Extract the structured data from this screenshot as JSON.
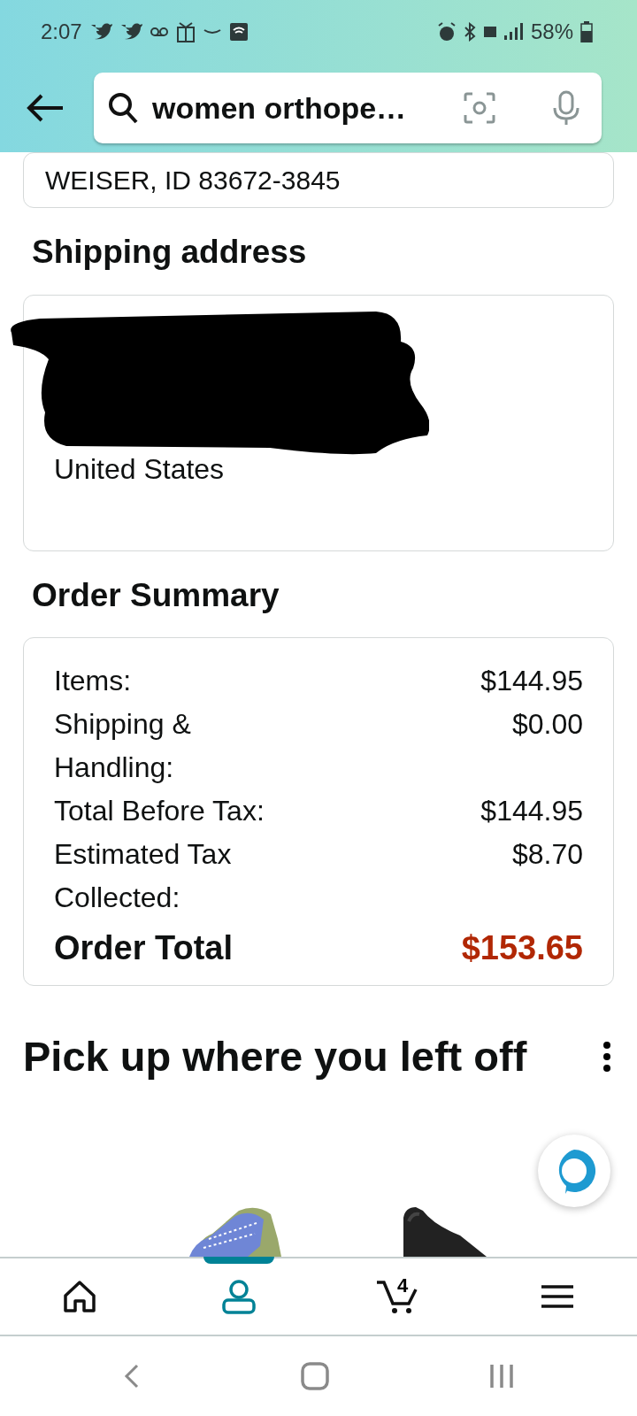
{
  "status_bar": {
    "time": "2:07",
    "battery": "58%"
  },
  "search": {
    "value": "women orthope…"
  },
  "previous_card": {
    "text": "WEISER, ID 83672-3845"
  },
  "shipping_address": {
    "title": "Shipping address",
    "redacted": true,
    "country": "United States"
  },
  "order_summary": {
    "title": "Order Summary",
    "rows": [
      {
        "label": "Items:",
        "value": "$144.95",
        "kind": "line"
      },
      {
        "label": "Shipping & Handling:",
        "value": "$0.00",
        "kind": "line"
      },
      {
        "label": "Total Before Tax:",
        "value": "$144.95",
        "kind": "line"
      },
      {
        "label": "Estimated Tax Collected:",
        "value": "$8.70",
        "kind": "line"
      },
      {
        "label": "Order Total",
        "value": "$153.65",
        "kind": "total"
      }
    ]
  },
  "recommendations": {
    "title": "Pick up where you left off"
  },
  "bottom_nav": [
    {
      "kind": "home",
      "selected": false
    },
    {
      "kind": "account",
      "selected": true
    },
    {
      "kind": "cart",
      "selected": false,
      "count": "4"
    },
    {
      "kind": "menu",
      "selected": false
    }
  ]
}
